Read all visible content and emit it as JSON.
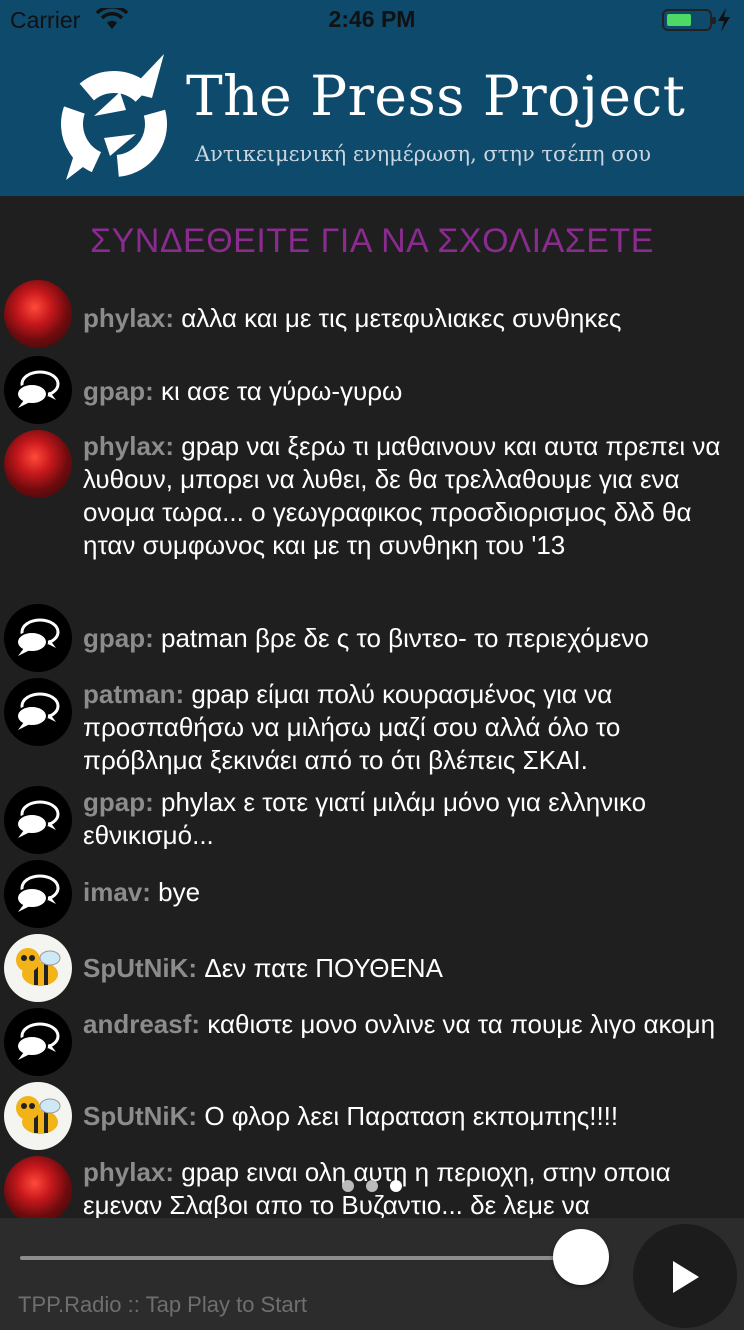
{
  "status_bar": {
    "carrier": "Carrier",
    "time": "2:46 PM"
  },
  "header": {
    "title": "The Press Project",
    "subtitle": "Αντικειμενική ενημέρωση, στην τσέπη σου"
  },
  "login_banner": "ΣΥΝΔΕΘΕΙΤΕ ΓΙΑ ΝΑ ΣΧΟΛΙΑΣΕΤΕ",
  "messages": [
    {
      "user": "phylax:",
      "text": "αλλα και με τις μετεφυλιακες συνθηκες",
      "avatar": "red-figure"
    },
    {
      "user": "gpap:",
      "text": "κι ασε τα γύρω-γυρω",
      "avatar": "speech-bubbles"
    },
    {
      "user": "phylax:",
      "text": "gpap ναι ξερω τι μαθαινουν και αυτα πρεπει να λυθουν, μπορει να λυθει, δε θα τρελλαθουμε για ενα ονομα τωρα... ο γεωγραφικος προσδιορισμος δλδ θα ηταν συμφωνος και με τη συνθηκη του '13",
      "avatar": "red-figure"
    },
    {
      "user": "gpap:",
      "text": "patman βρε δε ς το βιντεο- το περιεχόμενο",
      "avatar": "speech-bubbles"
    },
    {
      "user": "patman:",
      "text": "gpap είμαι πολύ κουρασμένος για να προσπαθήσω να μιλήσω μαζί σου αλλά όλο το πρόβλημα ξεκινάει από το ότι βλέπεις ΣΚΑΙ.",
      "avatar": "speech-bubbles"
    },
    {
      "user": "gpap:",
      "text": "phylax ε τοτε γιατί μιλάμ μόνο για ελληνικο εθνικισμό...",
      "avatar": "speech-bubbles"
    },
    {
      "user": "imav:",
      "text": "bye",
      "avatar": "speech-bubbles"
    },
    {
      "user": "SpUtNiK:",
      "text": "Δεν πατε ΠΟΥΘΕΝΑ",
      "avatar": "bee"
    },
    {
      "user": "andreasf:",
      "text": "καθιστε μονο ονλινε να τα πουμε λιγο ακομη",
      "avatar": "speech-bubbles"
    },
    {
      "user": "SpUtNiK:",
      "text": "Ο φλορ λεει Παραταση  εκπομπης!!!!",
      "avatar": "bee"
    },
    {
      "user": "phylax:",
      "text": "gpap ειναι ολη αυτη η περιοχη, στην οποια εμεναν Σλαβοι απο το Βυζαντιο... δε λεμε να",
      "avatar": "red-figure"
    }
  ],
  "pager": {
    "pages": 3,
    "current": 3
  },
  "player": {
    "status": "TPP.Radio :: Tap Play to Start",
    "progress": 0.97
  },
  "colors": {
    "header_bg": "#0d4a6b",
    "banner": "#8a2b8f",
    "background": "#1f1f1f"
  }
}
